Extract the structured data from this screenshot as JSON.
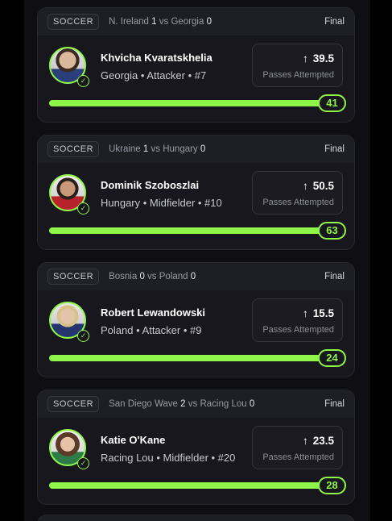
{
  "cards": [
    {
      "sport": "SOCCER",
      "home_team": "N. Ireland",
      "home_score": "1",
      "vs": "vs",
      "away_team": "Georgia",
      "away_score": "0",
      "status": "Final",
      "player_name": "Khvicha Kvaratskhelia",
      "player_meta": "Georgia • Attacker • #7",
      "line": "39.5",
      "stat_label": "Passes Attempted",
      "actual": "41",
      "progress_pct": 100
    },
    {
      "sport": "SOCCER",
      "home_team": "Ukraine",
      "home_score": "1",
      "vs": "vs",
      "away_team": "Hungary",
      "away_score": "0",
      "status": "Final",
      "player_name": "Dominik Szoboszlai",
      "player_meta": "Hungary • Midfielder • #10",
      "line": "50.5",
      "stat_label": "Passes Attempted",
      "actual": "63",
      "progress_pct": 100
    },
    {
      "sport": "SOCCER",
      "home_team": "Bosnia",
      "home_score": "0",
      "vs": "vs",
      "away_team": "Poland",
      "away_score": "0",
      "status": "Final",
      "player_name": "Robert Lewandowski",
      "player_meta": "Poland • Attacker • #9",
      "line": "15.5",
      "stat_label": "Passes Attempted",
      "actual": "24",
      "progress_pct": 100
    },
    {
      "sport": "SOCCER",
      "home_team": "San Diego Wave",
      "home_score": "2",
      "vs": "vs",
      "away_team": "Racing Lou",
      "away_score": "0",
      "status": "Final",
      "player_name": "Katie O'Kane",
      "player_meta": "Racing Lou • Midfielder • #20",
      "line": "23.5",
      "stat_label": "Passes Attempted",
      "actual": "28",
      "progress_pct": 100
    }
  ],
  "icons": {
    "arrow": "arrow-up-icon",
    "check": "checkmark-icon"
  },
  "colors": {
    "accent": "#8ff548",
    "card_bg": "#17171d",
    "header_bg": "#1e1e25"
  }
}
